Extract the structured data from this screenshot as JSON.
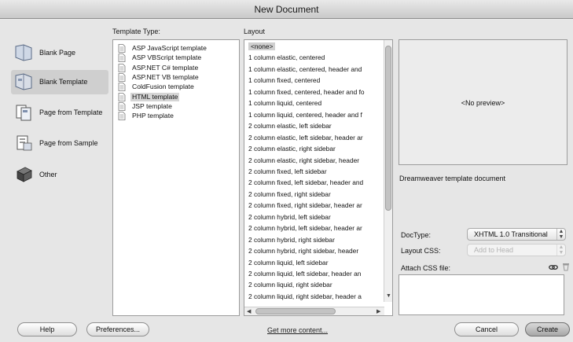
{
  "window": {
    "title": "New Document"
  },
  "headers": {
    "template_type": "Template Type:",
    "layout": "Layout"
  },
  "categories": [
    {
      "label": "Blank Page",
      "icon": "blank-page-icon"
    },
    {
      "label": "Blank Template",
      "icon": "blank-template-icon"
    },
    {
      "label": "Page from Template",
      "icon": "page-from-template-icon"
    },
    {
      "label": "Page from Sample",
      "icon": "page-from-sample-icon"
    },
    {
      "label": "Other",
      "icon": "other-icon"
    }
  ],
  "template_types": [
    "ASP JavaScript template",
    "ASP VBScript template",
    "ASP.NET C# template",
    "ASP.NET VB template",
    "ColdFusion template",
    "HTML template",
    "JSP template",
    "PHP template"
  ],
  "layouts": [
    "<none>",
    "1 column elastic, centered",
    "1 column elastic, centered, header and",
    "1 column fixed, centered",
    "1 column fixed, centered, header and fo",
    "1 column liquid, centered",
    "1 column liquid, centered, header and f",
    "2 column elastic, left sidebar",
    "2 column elastic, left sidebar, header ar",
    "2 column elastic, right sidebar",
    "2 column elastic, right sidebar, header",
    "2 column fixed, left sidebar",
    "2 column fixed, left sidebar, header and",
    "2 column fixed, right sidebar",
    "2 column fixed, right sidebar, header ar",
    "2 column hybrid, left sidebar",
    "2 column hybrid, left sidebar, header ar",
    "2 column hybrid, right sidebar",
    "2 column hybrid, right sidebar, header",
    "2 column liquid, left sidebar",
    "2 column liquid, left sidebar, header an",
    "2 column liquid, right sidebar",
    "2 column liquid, right sidebar, header a"
  ],
  "preview": {
    "placeholder": "<No preview>",
    "description": "Dreamweaver template document"
  },
  "options": {
    "doctype_label": "DocType:",
    "doctype_value": "XHTML 1.0 Transitional",
    "layout_css_label": "Layout CSS:",
    "layout_css_value": "Add to Head",
    "attach_css_label": "Attach CSS file:"
  },
  "buttons": {
    "help": "Help",
    "preferences": "Preferences...",
    "get_more": "Get more content...",
    "cancel": "Cancel",
    "create": "Create"
  }
}
